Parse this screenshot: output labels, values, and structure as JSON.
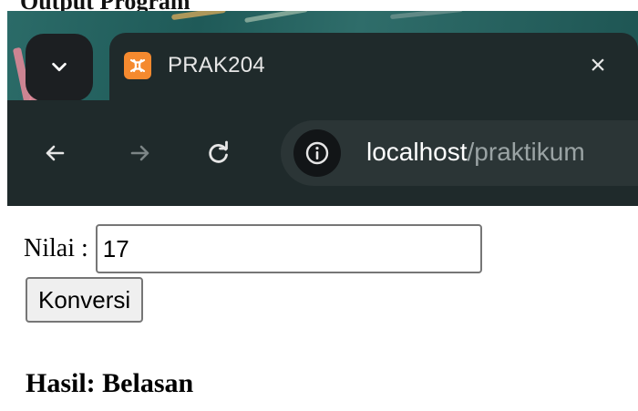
{
  "caption": "Output Program",
  "browser": {
    "tab": {
      "title": "PRAK204",
      "favicon": "xampp-icon",
      "close_icon": "close-icon",
      "close_glyph": "×"
    },
    "toolbar": {
      "back_icon": "back-arrow-icon",
      "forward_icon": "forward-arrow-icon",
      "reload_icon": "reload-icon",
      "site_info_icon": "info-icon"
    },
    "address": {
      "host": "localhost",
      "path": "/praktikum"
    }
  },
  "form": {
    "label": "Nilai :",
    "input_value": "17",
    "button_label": "Konversi"
  },
  "result": {
    "text": "Hasil: Belasan"
  },
  "colors": {
    "tab_bg": "#1f2a2b",
    "theme_teal": "#2b6b68",
    "favicon_orange": "#f58a2f",
    "text_light": "#e6e6e6"
  }
}
